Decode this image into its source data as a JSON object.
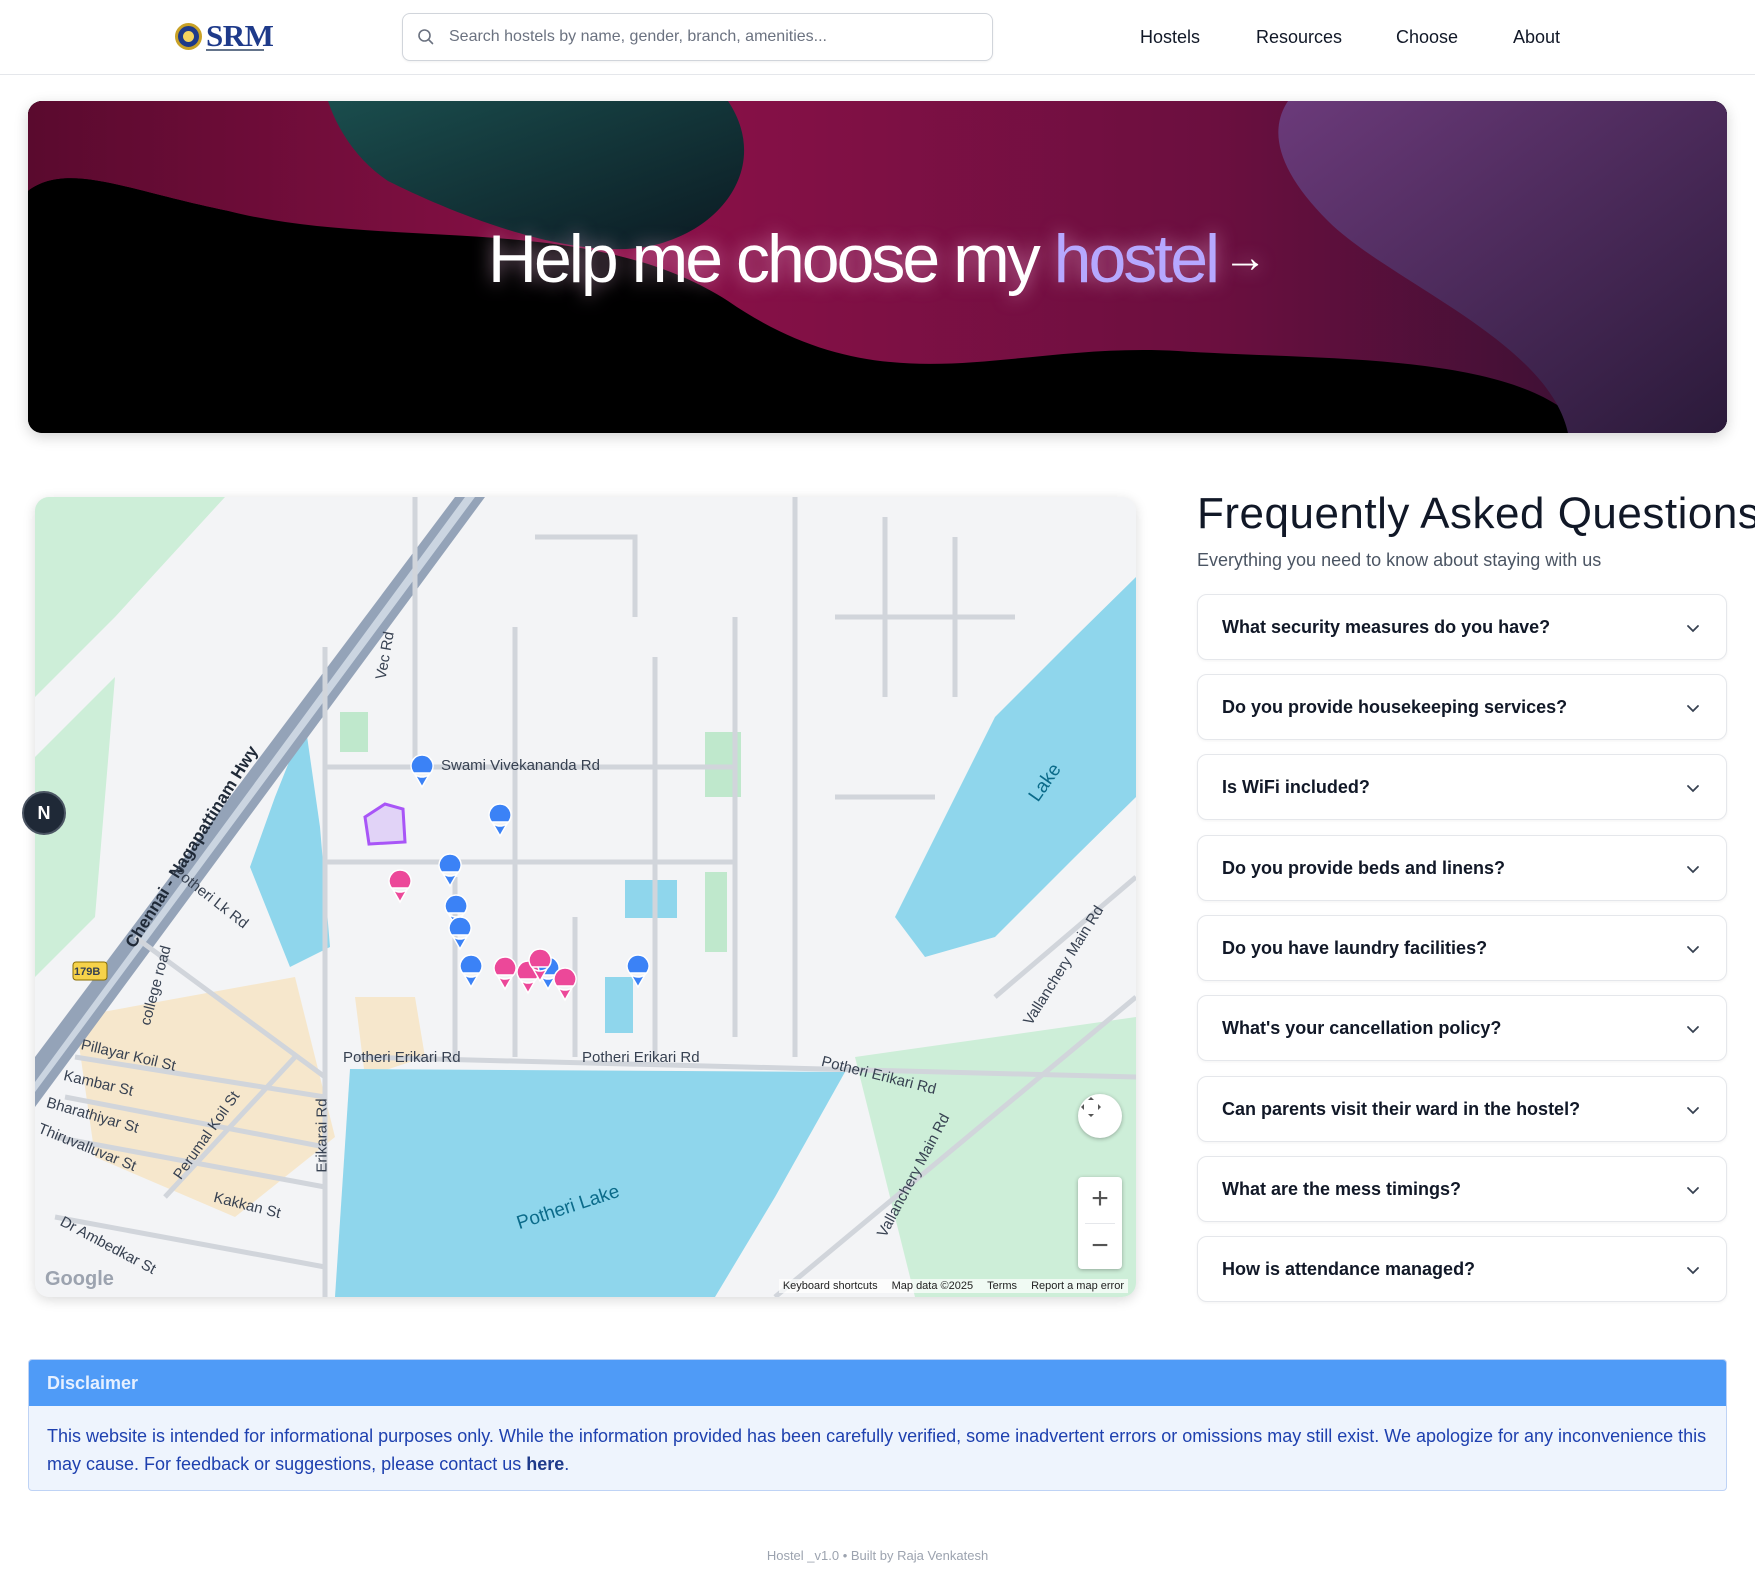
{
  "header": {
    "logo_text": "SRM",
    "search_placeholder": "Search hostels by name, gender, branch, amenities...",
    "nav": [
      "Hostels",
      "Resources",
      "Choose",
      "About"
    ]
  },
  "hero": {
    "title_main": "Help me choose my",
    "title_accent": "hostel",
    "arrow": "→"
  },
  "map": {
    "labels": {
      "swami": "Swami Vivekananda Rd",
      "vec": "Vec Rd",
      "highway": "Chennai - Nagapattinam Hwy",
      "lake_rd": "Potheri Lk Rd",
      "college": "college road",
      "shield": "179B",
      "pillayar": "Pillayar Koil St",
      "kambar": "Kambar St",
      "bharathiyar": "Bharathiyar St",
      "thiruvalluvar": "Thiruvalluvar St",
      "perumal": "Perumal Koil St",
      "erikarai": "Erikarai Rd",
      "potheri_erikari_1": "Potheri Erikari Rd",
      "potheri_erikari_2": "Potheri Erikari Rd",
      "potheri_erikari_3": "Potheri Erikari Rd",
      "kakkan": "Kakkan St",
      "ambedkar": "Dr Ambedkar St",
      "potheri_lake": "Potheri Lake",
      "lake": "Lake",
      "vallanchery_1": "Vallanchery Main Rd",
      "vallanchery_2": "Vallanchery Main Rd"
    },
    "google": "Google",
    "footer": [
      "Keyboard shortcuts",
      "Map data ©2025",
      "Terms",
      "Report a map error"
    ],
    "zoom_in": "+",
    "zoom_out": "−",
    "compass": "N",
    "colors": {
      "blue_pin": "#3b82f6",
      "pink_pin": "#ec4899",
      "water": "#8fd6ec",
      "park": "#cdeed8"
    }
  },
  "faq": {
    "title": "Frequently Asked Questions",
    "subtitle": "Everything you need to know about staying with us",
    "items": [
      "What security measures do you have?",
      "Do you provide housekeeping services?",
      "Is WiFi included?",
      "Do you provide beds and linens?",
      "Do you have laundry facilities?",
      "What's your cancellation policy?",
      "Can parents visit their ward in the hostel?",
      "What are the mess timings?",
      "How is attendance managed?"
    ]
  },
  "disclaimer": {
    "heading": "Disclaimer",
    "text": "This website is intended for informational purposes only. While the information provided has been carefully verified, some inadvertent errors or omissions may still exist. We apologize for any inconvenience this may cause. For feedback or suggestions, please contact us ",
    "link": "here",
    "end": "."
  },
  "footer": {
    "text": "Hostel _v1.0 • Built by Raja Venkatesh"
  }
}
